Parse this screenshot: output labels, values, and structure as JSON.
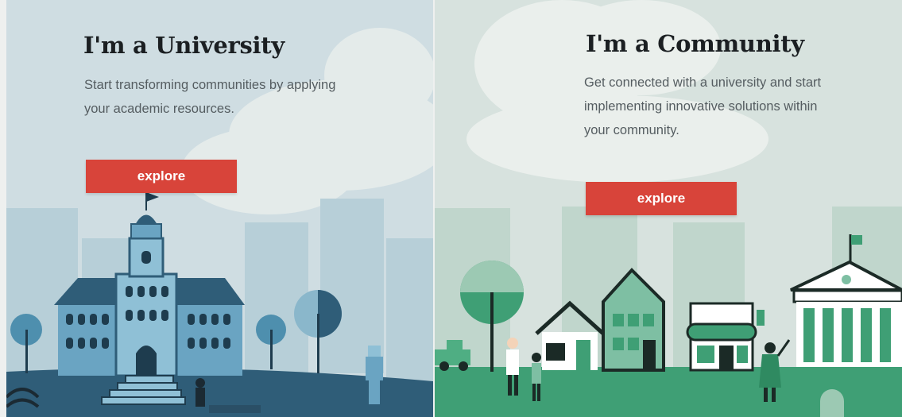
{
  "university": {
    "title": "I'm a University",
    "description": "Start transforming communities by applying your academic resources.",
    "button_label": "explore",
    "illustration": "university-campus-illustration"
  },
  "community": {
    "title": "I'm a Community",
    "description": "Get connected with a university and start implementing innovative solutions within your community.",
    "button_label": "explore",
    "illustration": "town-street-illustration"
  },
  "colors": {
    "accent_button": "#d8443a",
    "university_bg": "#cfdde2",
    "university_dark": "#2f5d78",
    "community_bg": "#d7e2de",
    "community_green": "#3f9f75"
  }
}
